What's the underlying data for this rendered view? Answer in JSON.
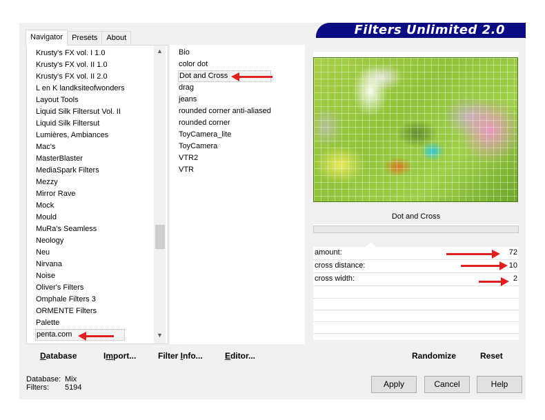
{
  "tabs": [
    "Navigator",
    "Presets",
    "About"
  ],
  "banner_title": "Filters Unlimited 2.0",
  "categories": [
    "Krusty's FX vol. I 1.0",
    "Krusty's FX vol. II 1.0",
    "Krusty's FX vol. II 2.0",
    "L en K landksiteofwonders",
    "Layout Tools",
    "Liquid Silk Filtersut Vol. II",
    "Liquid Silk Filtersut",
    "Lumières, Ambiances",
    "Mac's",
    "MasterBlaster",
    "MediaSpark Filters",
    "Mezzy",
    "Mirror Rave",
    "Mock",
    "Mould",
    "MuRa's Seamless",
    "Neology",
    "Neu",
    "Nirvana",
    "Noise",
    "Oliver's Filters",
    "Omphale Filters 3",
    "ORMENTE Filters",
    "Palette",
    "penta.com"
  ],
  "selected_category": "penta.com",
  "filters": [
    "Bio",
    "color dot",
    "Dot and Cross",
    "drag",
    "jeans",
    "rounded corner anti-aliased",
    "rounded corner",
    "ToyCamera_lite",
    "ToyCamera",
    "VTR2",
    "VTR"
  ],
  "selected_filter": "Dot and Cross",
  "params": {
    "title": "Dot and Cross",
    "rows": [
      {
        "label": "amount:",
        "value": "72"
      },
      {
        "label": "cross distance:",
        "value": "10"
      },
      {
        "label": "cross width:",
        "value": "2"
      }
    ]
  },
  "left_buttons": {
    "database": {
      "ul": "D",
      "rest": "atabase"
    },
    "import": {
      "pre": "I",
      "ul": "m",
      "rest": "port..."
    },
    "filter_info": {
      "pre": "Filter ",
      "ul": "I",
      "rest": "nfo..."
    },
    "editor": {
      "ul": "E",
      "rest": "ditor..."
    }
  },
  "right_buttons": {
    "randomize": "Randomize",
    "reset": "Reset"
  },
  "status": {
    "database_label": "Database:",
    "database_value": "Mix",
    "filters_label": "Filters:",
    "filters_value": "5194"
  },
  "dialog_buttons": {
    "apply": "Apply",
    "cancel": "Cancel",
    "help": "Help"
  },
  "colors": {
    "banner": "#0b0b82",
    "arrow": "#e02020"
  }
}
